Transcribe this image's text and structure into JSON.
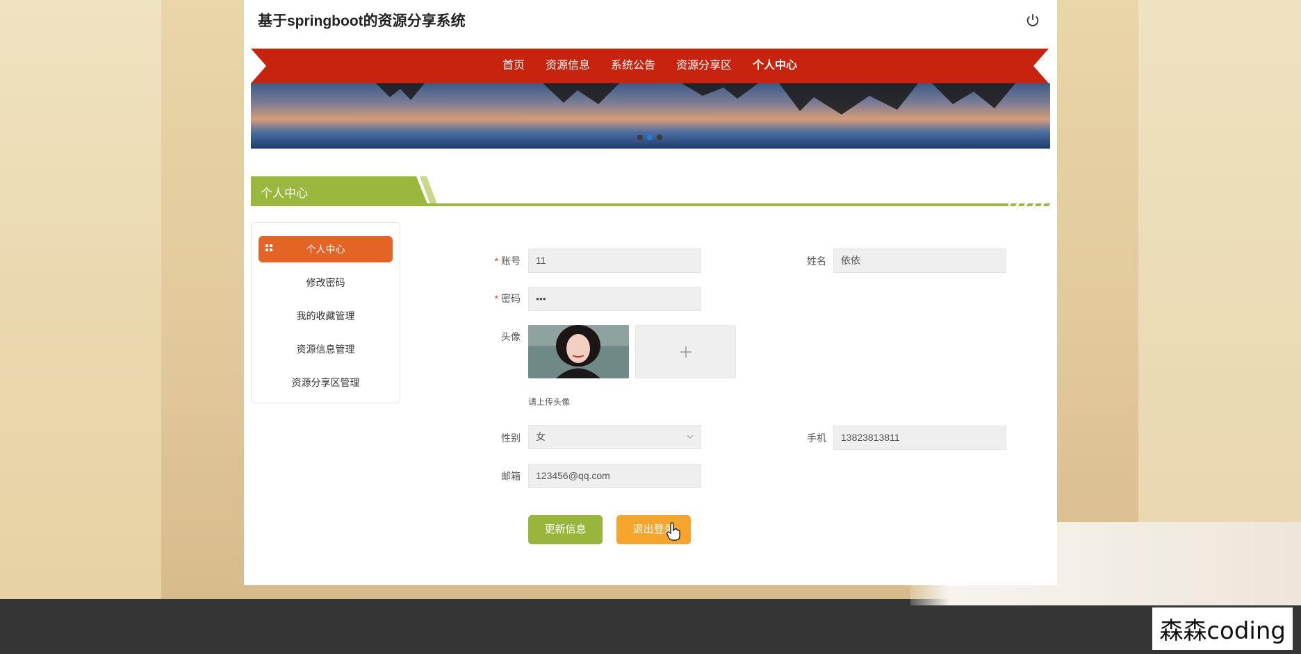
{
  "site": {
    "title": "基于springboot的资源分享系统"
  },
  "nav": {
    "items": [
      {
        "label": "首页",
        "active": false
      },
      {
        "label": "资源信息",
        "active": false
      },
      {
        "label": "系统公告",
        "active": false
      },
      {
        "label": "资源分享区",
        "active": false
      },
      {
        "label": "个人中心",
        "active": true
      }
    ]
  },
  "banner": {
    "slide_count": 3,
    "active_slide": 2
  },
  "section": {
    "title": "个人中心"
  },
  "sidebar": {
    "items": [
      {
        "label": "个人中心",
        "active": true
      },
      {
        "label": "修改密码",
        "active": false
      },
      {
        "label": "我的收藏管理",
        "active": false
      },
      {
        "label": "资源信息管理",
        "active": false
      },
      {
        "label": "资源分享区管理",
        "active": false
      }
    ]
  },
  "form": {
    "account": {
      "label": "账号",
      "value": "11",
      "required": true
    },
    "name": {
      "label": "姓名",
      "value": "依依",
      "required": false
    },
    "password": {
      "label": "密码",
      "value": "•••",
      "required": true
    },
    "avatar": {
      "label": "头像",
      "hint": "请上传头像"
    },
    "gender": {
      "label": "性别",
      "value": "女"
    },
    "phone": {
      "label": "手机",
      "value": "13823813811"
    },
    "email": {
      "label": "邮箱",
      "value": "123456@qq.com"
    }
  },
  "buttons": {
    "update": "更新信息",
    "logout": "退出登录"
  },
  "watermark": "森森coding",
  "colors": {
    "nav_red": "#c8230f",
    "section_green": "#9ab83e",
    "sidebar_active": "#e36425",
    "btn_green": "#99b63c",
    "btn_orange": "#f6a52c"
  }
}
